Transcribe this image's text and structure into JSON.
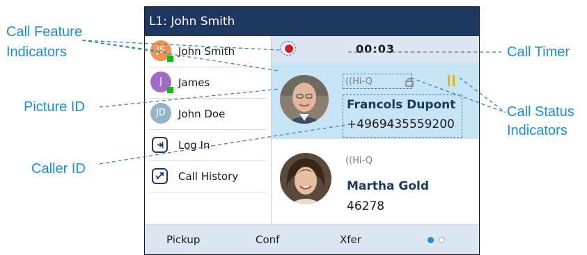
{
  "screen": {
    "title": "L1: John Smith",
    "lines": [
      {
        "initials": "JS",
        "label": "John Smith",
        "avatar_color": "#f4944f",
        "presence": true
      },
      {
        "initials": "J",
        "label": "James",
        "avatar_color": "#a06ac7",
        "presence": true
      },
      {
        "initials": "JD",
        "label": "John Doe",
        "avatar_color": "#94b4c9",
        "presence": false
      },
      {
        "icon": "login-icon",
        "label": "Log In"
      },
      {
        "icon": "call-history-icon",
        "label": "Call History"
      }
    ],
    "timer": "00:03",
    "calls": [
      {
        "status": "Hi-Q",
        "name": "Francols Dupont",
        "number": "+4969435559200",
        "active": true
      },
      {
        "status": "Hi-Q",
        "name": "Martha Gold",
        "number": "46278",
        "active": false
      }
    ],
    "softkeys": [
      "Pickup",
      "Conf",
      "Xfer"
    ],
    "page_indicator": {
      "pages": 2,
      "current": 1
    }
  },
  "callouts": {
    "call_feature_1": "Call Feature",
    "call_feature_2": "Indicators",
    "picture_id": "Picture ID",
    "caller_id": "Caller ID",
    "call_timer": "Call Timer",
    "call_status_1": "Call Status",
    "call_status_2": "Indicators"
  },
  "colors": {
    "title_bar": "#1d3761",
    "timer_bar": "#dce5f0",
    "active_call": "#c7e3f6",
    "callout_text": "#1a8fd6",
    "presence": "#1bb61b",
    "recording": "#d11f2a",
    "pause": "#e8b400"
  }
}
